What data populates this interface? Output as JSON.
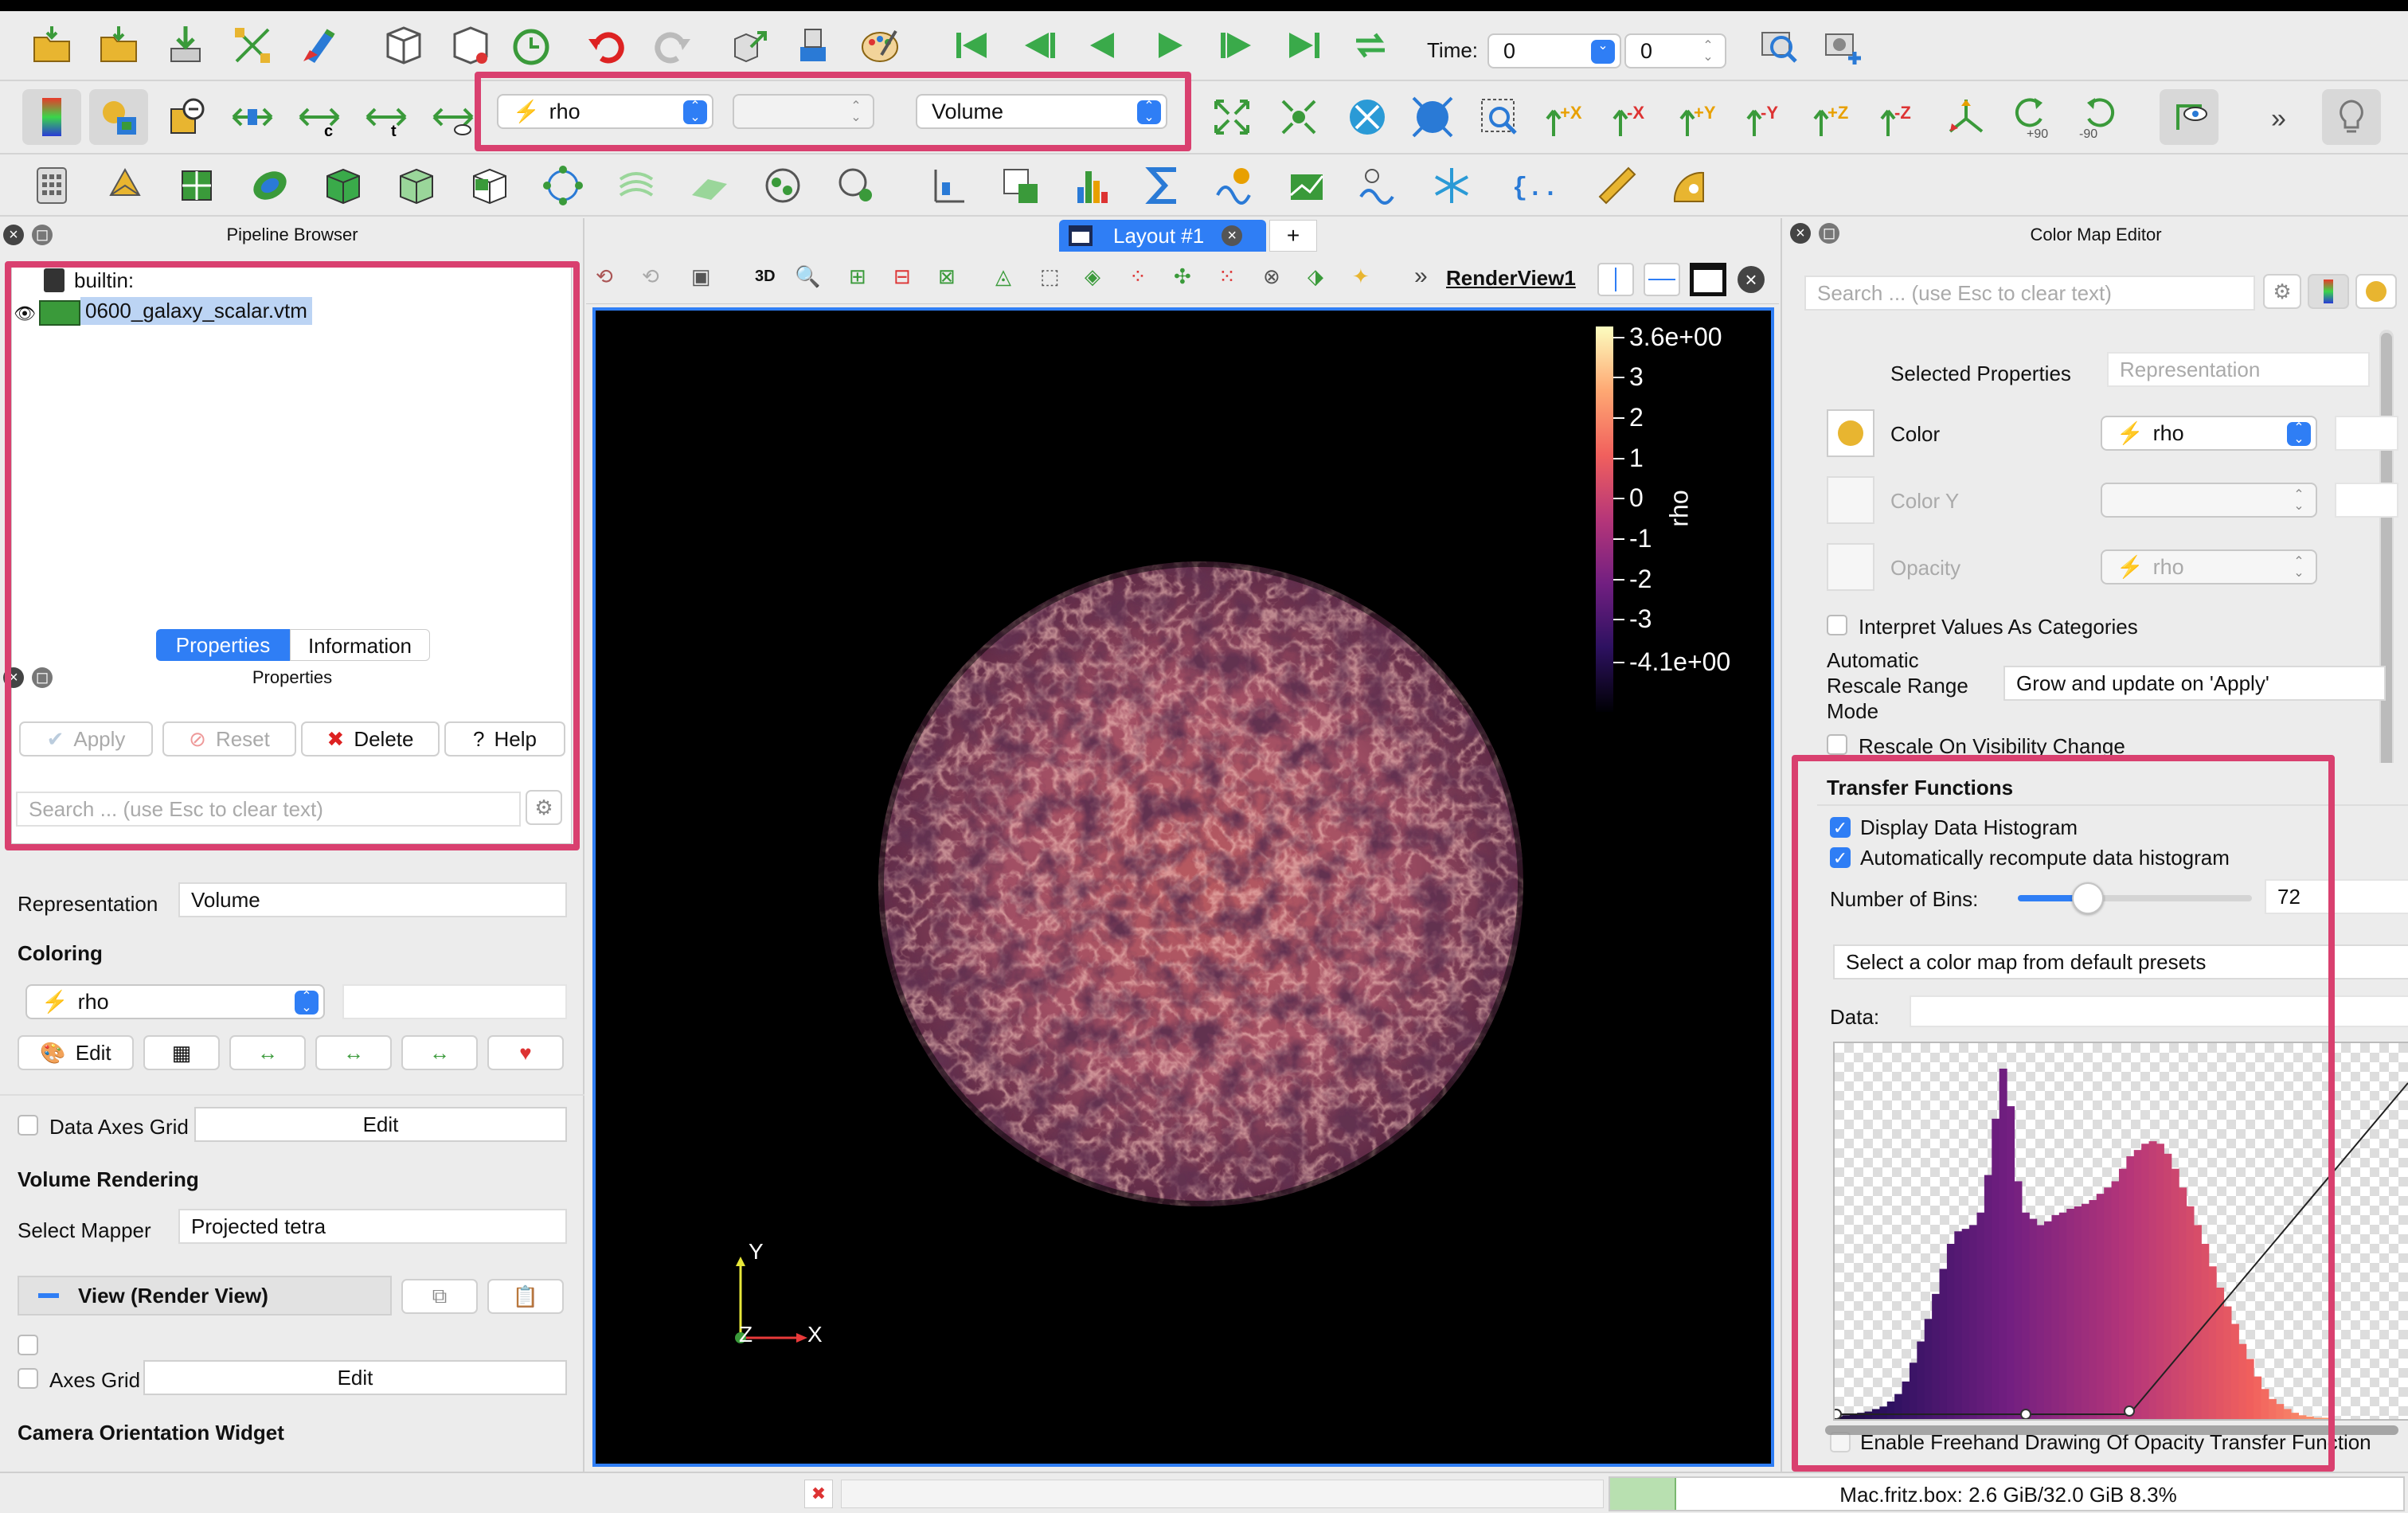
{
  "toolbar": {
    "time_label": "Time:",
    "time_value": "0",
    "time_step": "0",
    "array_combo": "rho",
    "component_combo": "",
    "representation_combo": "Volume",
    "rot_plus": "+90",
    "rot_minus": "-90",
    "axis_labels": [
      "+X",
      "-X",
      "+Y",
      "-Y",
      "+Z",
      "-Z"
    ]
  },
  "pipeline": {
    "title": "Pipeline Browser",
    "items": [
      "builtin:",
      "0600_galaxy_scalar.vtm"
    ]
  },
  "props": {
    "tabs": [
      "Properties",
      "Information"
    ],
    "title": "Properties",
    "apply": "Apply",
    "reset": "Reset",
    "delete": "Delete",
    "help": "Help",
    "search_placeholder": "Search ... (use Esc to clear text)",
    "representation_label": "Representation",
    "representation_value": "Volume",
    "coloring_heading": "Coloring",
    "coloring_value": "rho",
    "edit_label": "Edit",
    "data_axes_grid": "Data Axes Grid",
    "grid_edit": "Edit",
    "volume_rendering": "Volume Rendering",
    "select_mapper": "Select Mapper",
    "mapper_value": "Projected tetra",
    "view_section": "View (Render View)",
    "axes_grid": "Axes Grid",
    "axes_grid_edit": "Edit",
    "camera_widget": "Camera Orientation Widget"
  },
  "layout": {
    "tab": "Layout #1",
    "plus": "+",
    "view_name": "RenderView1",
    "mode_3d": "3D"
  },
  "colorbar": {
    "title": "rho",
    "ticks": [
      "3.6e+00",
      "3",
      "2",
      "1",
      "0",
      "-1",
      "-2",
      "-3",
      "-4.1e+00"
    ]
  },
  "axes": {
    "x": "X",
    "y": "Y",
    "z": "Z"
  },
  "cme": {
    "title": "Color Map Editor",
    "search_placeholder": "Search ... (use Esc to clear text)",
    "selected_properties": "Selected Properties",
    "representation": "Representation",
    "color_label": "Color",
    "color_value": "rho",
    "color_y": "Color Y",
    "opacity": "Opacity",
    "opacity_value": "rho",
    "interpret": "Interpret Values As Categories",
    "auto_rescale_l1": "Automatic",
    "auto_rescale_l2": "Rescale Range",
    "auto_rescale_l3": "Mode",
    "rescale_value": "Grow and update on 'Apply'",
    "rescale_visibility": "Rescale On Visibility Change",
    "transfer_functions": "Transfer Functions",
    "display_hist": "Display Data Histogram",
    "auto_hist": "Automatically recompute data histogram",
    "bins_label": "Number of Bins:",
    "bins_value": "72",
    "bins_fraction": 0.3,
    "preset": "Select a color map from default presets",
    "data_label": "Data:",
    "freehand": "Enable Freehand Drawing Of Opacity Transfer Function"
  },
  "status": {
    "memory": "Mac.fritz.box: 2.6 GiB/32.0 GiB 8.3%",
    "memory_fraction": 0.083
  },
  "histogram": [
    2,
    3,
    4,
    5,
    6,
    8,
    10,
    14,
    20,
    30,
    45,
    62,
    80,
    100,
    120,
    140,
    150,
    152,
    155,
    165,
    195,
    240,
    280,
    250,
    190,
    165,
    160,
    155,
    158,
    163,
    165,
    168,
    170,
    172,
    175,
    180,
    185,
    190,
    200,
    210,
    215,
    220,
    222,
    220,
    212,
    200,
    185,
    170,
    155,
    140,
    122,
    105,
    90,
    76,
    60,
    48,
    34,
    24,
    16,
    12,
    8,
    5,
    3,
    2,
    1,
    1
  ]
}
